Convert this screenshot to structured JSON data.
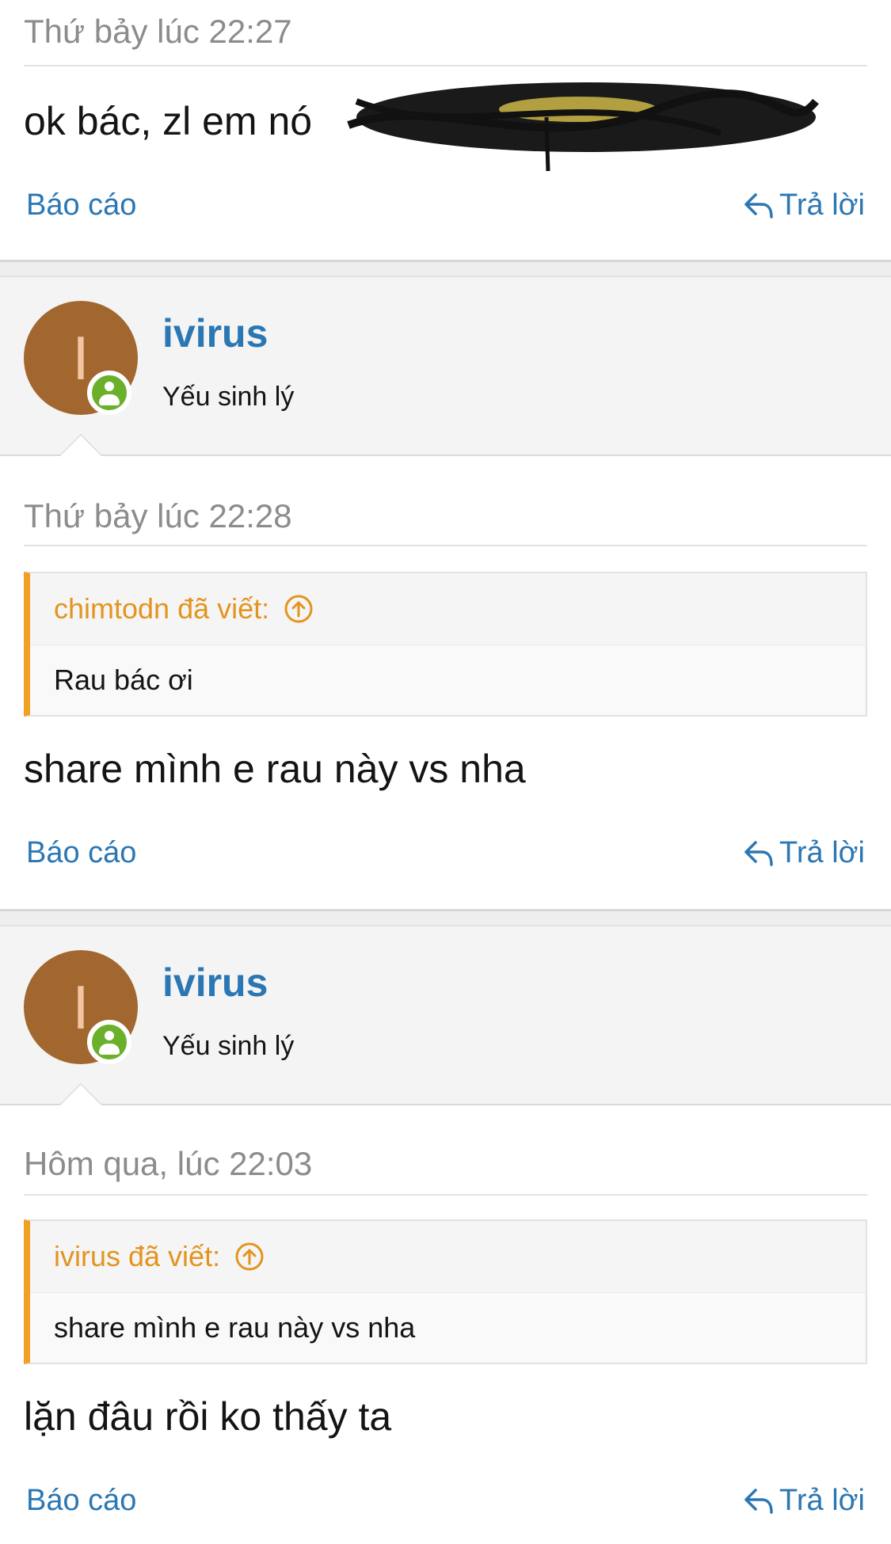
{
  "posts": [
    {
      "date": "Thứ bảy lúc 22:27",
      "message": "ok bác, zl em nó",
      "report_label": "Báo cáo",
      "reply_label": "Trả lời"
    },
    {
      "user": {
        "name": "ivirus",
        "title": "Yếu sinh lý",
        "avatar_letter": "I"
      },
      "date": "Thứ bảy lúc 22:28",
      "quote": {
        "header": "chimtodn đã viết:",
        "text": "Rau bác ơi"
      },
      "message": "share mình e rau này vs nha",
      "report_label": "Báo cáo",
      "reply_label": "Trả lời"
    },
    {
      "user": {
        "name": "ivirus",
        "title": "Yếu sinh lý",
        "avatar_letter": "I"
      },
      "date": "Hôm qua, lúc 22:03",
      "quote": {
        "header": "ivirus đã viết:",
        "text": "share mình e rau này vs nha"
      },
      "message": "lặn đâu rồi ko thấy ta",
      "report_label": "Báo cáo",
      "reply_label": "Trả lời"
    }
  ],
  "colors": {
    "link": "#2b77b3",
    "quote_accent": "#f0a023",
    "avatar_bg": "#a2672f",
    "online_badge": "#6bb02b"
  },
  "icons": {
    "reply": "reply-arrow-icon",
    "quote_jump": "arrow-up-circle-icon",
    "online": "user-online-icon"
  }
}
